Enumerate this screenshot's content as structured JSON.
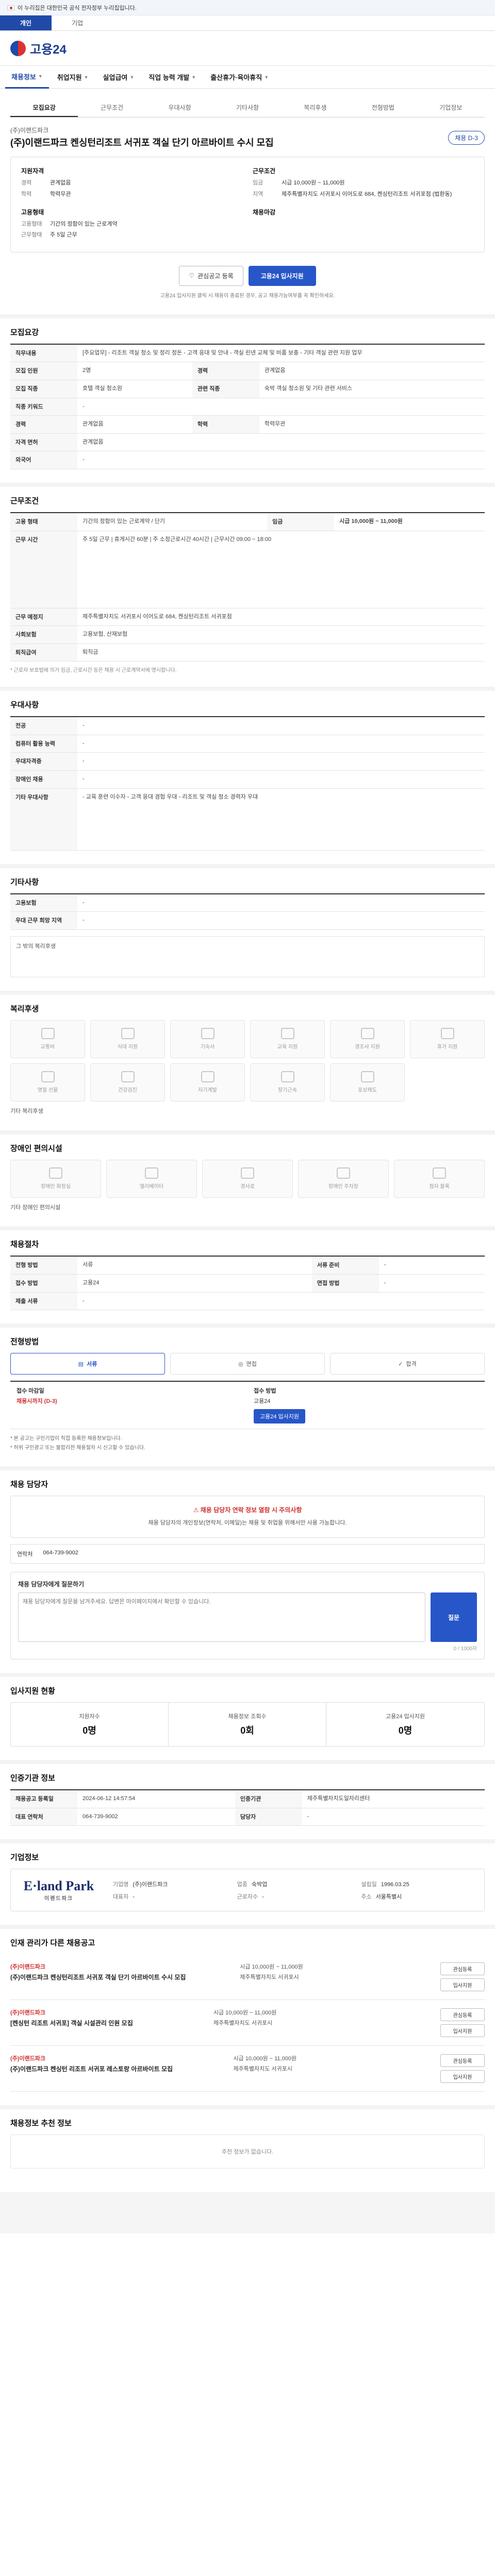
{
  "gov_banner": {
    "text": "이 누리집은 대한민국 공식 전자정부 누리집입니다."
  },
  "top_tabs": [
    "개인",
    "기업"
  ],
  "logo": {
    "text": "고용24"
  },
  "gnb": [
    "채용정보",
    "취업지원",
    "실업급여",
    "직업 능력 개발",
    "출산휴가·육아휴직"
  ],
  "sub_tabs": [
    "모집요강",
    "근무조건",
    "우대사항",
    "기타사항",
    "복리후생",
    "전형방법",
    "기업정보"
  ],
  "job": {
    "company": "(주)이랜드파크",
    "title": "(주)이랜드파크 켄싱턴리조트 서귀포 객실 단기 아르바이트 수시 모집",
    "status_pill": "채용 D-3",
    "left_col_title": "지원자격",
    "left_kv": [
      {
        "k": "경력",
        "v": "관계없음"
      },
      {
        "k": "학력",
        "v": "학력무관"
      }
    ],
    "left_col_title2": "고용형태",
    "left_kv2": [
      {
        "k": "고용형태",
        "v": "기간의 정함이 있는 근로계약"
      },
      {
        "k": "근무형태",
        "v": "주 5일 근무"
      }
    ],
    "right_col_title": "근무조건",
    "right_kv": [
      {
        "k": "임금",
        "v": "시급 10,000원 ~ 11,000원"
      },
      {
        "k": "지역",
        "v": "제주특별자치도 서귀포시 이어도로 684, 켄싱턴리조트 서귀포점 (법환동)"
      }
    ],
    "right_col_title2": "채용마감",
    "apply_scrap_label": "관심공고 등록",
    "apply_label": "고용24 입사지원",
    "notice": "고용24 입사지원 클릭 시 채용이 종료된 경우, 공고 채용가능여부를 꼭 확인하세요.",
    "notice_link": "고용24"
  },
  "recruit": {
    "title": "모집요강",
    "rows": [
      {
        "k": "직무내용",
        "v": "[주요업무] - 리조트 객실 청소 및 정리 정돈 - 고객 응대 및 안내 - 객실 린넨 교체 및 비품 보충 - 기타 객실 관련 지원 업무"
      },
      {
        "k": "모집 인원",
        "v": "2명"
      },
      {
        "k": "모집 직종",
        "v": "호텔 객실 청소원"
      },
      {
        "k": "직종 키워드",
        "v": "-"
      },
      {
        "k": "경력",
        "v": "관계없음"
      },
      {
        "k": "자격 면허",
        "v": "관계없음"
      },
      {
        "k": "외국어",
        "v": "-"
      }
    ],
    "side": [
      {
        "k": "경력",
        "v": "관계없음"
      },
      {
        "k": "관련 직종",
        "v": "숙박 객실 청소원 및 기타 관련 서비스"
      },
      {
        "k": "학력",
        "v": "학력무관"
      }
    ]
  },
  "work": {
    "title": "근무조건",
    "rows": [
      {
        "k": "고용 형태",
        "v": "기간의 정함이 있는 근로계약 / 단기"
      },
      {
        "k": "근무 시간",
        "v": "주 5일 근무 | 휴게시간 60분 | 주 소정근로시간 40시간 | 근무시간 09:00 ~ 18:00"
      },
      {
        "k": "근무 예정지",
        "v": "제주특별자치도 서귀포시 이어도로 684, 켄싱턴리조트 서귀포점"
      },
      {
        "k": "사회보험",
        "v": "고용보험, 산재보험"
      },
      {
        "k": "퇴직급여",
        "v": "퇴직금"
      }
    ],
    "wage": "시급 10,000원 ~ 11,000원",
    "note": "* 근로자 보호법에 의거 임금, 근로시간 등은 채용 시 근로계약서에 명시합니다."
  },
  "pref": {
    "title": "우대사항",
    "rows": [
      {
        "k": "전공",
        "v": "-"
      },
      {
        "k": "컴퓨터 활용 능력",
        "v": "-"
      },
      {
        "k": "우대자격증",
        "v": "-"
      },
      {
        "k": "장애인 채용",
        "v": "-"
      },
      {
        "k": "기타 우대사항",
        "v": "- 교육 훈련 이수자 - 고객 응대 경험 우대 - 리조트 및 객실 청소 경력자 우대"
      }
    ]
  },
  "etc": {
    "title": "기타사항",
    "rows": [
      {
        "k": "고용보험",
        "v": "-"
      },
      {
        "k": "우대 근무 희망 지역",
        "v": "-"
      }
    ],
    "extra": "그 밖의 복리후생"
  },
  "welfare": {
    "title": "복리후생",
    "icons": [
      "교통비",
      "식대 지원",
      "기숙사",
      "교육 지원",
      "경조사 지원",
      "휴가 지원",
      "명절 선물",
      "건강검진",
      "자기계발",
      "장기근속",
      "포상제도"
    ],
    "extra": "기타 복리후생"
  },
  "disabled": {
    "title": "장애인 편의시설",
    "icons": [
      "장애인 화장실",
      "엘리베이터",
      "경사로",
      "장애인 주차장",
      "점자 블록"
    ],
    "extra": "기타 장애인 편의시설"
  },
  "screening": {
    "title": "채용절차",
    "rows": [
      {
        "k": "전형 방법",
        "v": "서류"
      },
      {
        "k": "접수 방법",
        "v": "고용24"
      },
      {
        "k": "제출 서류",
        "v": "-"
      }
    ],
    "side": [
      {
        "k": "서류 준비",
        "v": "-"
      },
      {
        "k": "면접 방법",
        "v": "-"
      }
    ]
  },
  "method": {
    "title": "전형방법",
    "steps": [
      "서류",
      "면접",
      "합격"
    ],
    "apply_label": "접수 마감일",
    "apply_value": "채용시까지",
    "apply_note": "채용시까지 (D-3)",
    "contact_label": "접수 방법",
    "contact_value": "고용24",
    "button": "고용24 입사지원",
    "bullets": [
      "* 본 공고는 구인기업이 직접 등록한 채용정보입니다.",
      "* 허위 구인광고 또는 불합리한 채용절차 시 신고할 수 있습니다."
    ]
  },
  "contact": {
    "title": "채용 담당자",
    "warning": "채용 담당자 연락 정보 열람 시 주의사항",
    "text": "채용 담당자의 개인정보(연락처, 이메일)는 채용 및 취업을 위해서만 사용 가능합니다.",
    "line_label": "연락처",
    "line_value": "064-739-9002",
    "qa_title": "채용 담당자에게 질문하기",
    "qa_placeholder": "채용 담당자에게 질문을 남겨주세요. 답변은 마이페이지에서 확인할 수 있습니다.",
    "qa_button": "질문",
    "qa_count": "0 / 1000자"
  },
  "stats": {
    "title": "입사지원 현황",
    "items": [
      {
        "lbl": "지원자수",
        "num": "0명"
      },
      {
        "lbl": "채용정보 조회수",
        "num": "0회"
      },
      {
        "lbl": "고용24 입사지원",
        "num": "0명"
      }
    ]
  },
  "info": {
    "title": "인증기관 정보",
    "rows": [
      {
        "k": "채용공고 등록일",
        "v": "2024-06-12 14:57:54"
      },
      {
        "k": "대표 연락처",
        "v": "064-739-9002"
      }
    ],
    "side": [
      {
        "k": "인증기관",
        "v": "제주특별자치도일자리센터"
      },
      {
        "k": "담당자",
        "v": "-"
      }
    ]
  },
  "company": {
    "title": "기업정보",
    "logo_main": "E·land Park",
    "logo_sub": "이랜드파크",
    "grid": [
      {
        "k": "기업명",
        "v": "(주)이랜드파크"
      },
      {
        "k": "업종",
        "v": "숙박업"
      },
      {
        "k": "설립일",
        "v": "1996.03.25"
      },
      {
        "k": "대표자",
        "v": "-"
      },
      {
        "k": "근로자수",
        "v": "-"
      },
      {
        "k": "주소",
        "v": "서울특별시"
      }
    ]
  },
  "others": {
    "title": "인재 관리가 다른 채용공고",
    "items": [
      {
        "co": "(주)이랜드파크",
        "tt": "(주)이랜드파크 켄싱턴리조트 서귀포 객실 단기 아르바이트 수시 모집",
        "m1": "시급 10,000원 ~ 11,000원",
        "m2": "제주특별자치도 서귀포시"
      },
      {
        "co": "(주)이랜드파크",
        "tt": "[켄싱턴 리조트 서귀포] 객실 시설관리 인원 모집",
        "m1": "시급 10,000원 ~ 11,000원",
        "m2": "제주특별자치도 서귀포시"
      },
      {
        "co": "(주)이랜드파크",
        "tt": "(주)이랜드파크 켄싱턴 리조트 서귀포 레스토랑 아르바이트 모집",
        "m1": "시급 10,000원 ~ 11,000원",
        "m2": "제주특별자치도 서귀포시"
      }
    ],
    "btn1": "관심등록",
    "btn2": "입사지원"
  },
  "recommend": {
    "title": "채용정보 추천 정보",
    "text": "추천 정보가 없습니다."
  }
}
